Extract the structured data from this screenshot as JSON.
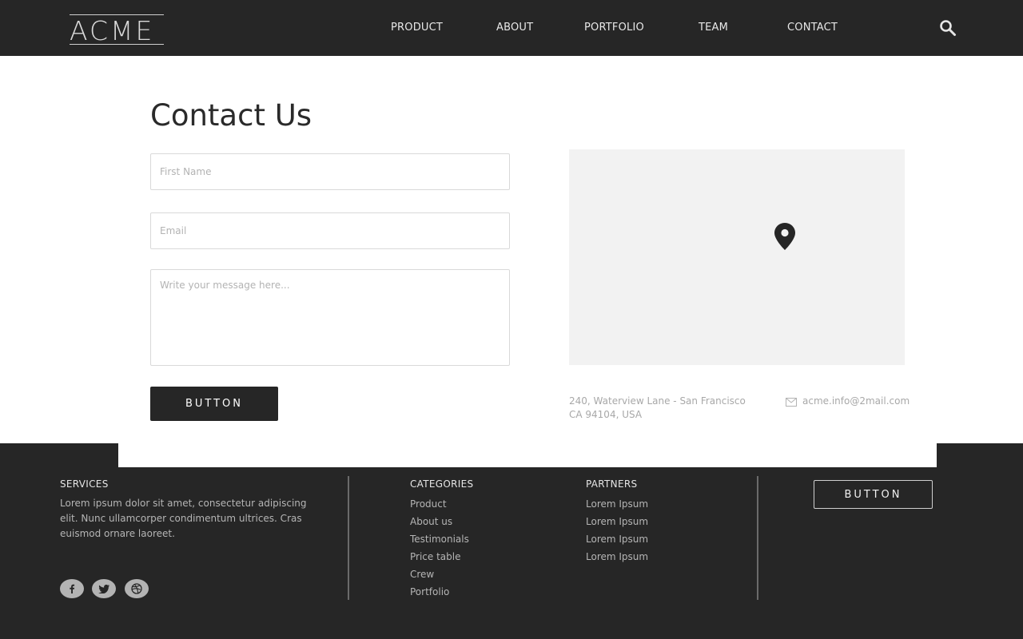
{
  "header": {
    "logo": "ACME",
    "nav": [
      "PRODUCT",
      "ABOUT",
      "PORTFOLIO",
      "TEAM",
      "CONTACT"
    ],
    "search_icon": "search-icon"
  },
  "contact": {
    "title": "Contact Us",
    "first_name_placeholder": "First Name",
    "email_placeholder": "Email",
    "message_placeholder": "Write your message here...",
    "button_label": "BUTTON",
    "map_icon": "map-pin-icon",
    "address_line1": "240, Waterview Lane - San Francisco",
    "address_line2": "CA 94104, USA",
    "email_icon": "mail-icon",
    "email": "acme.info@2mail.com"
  },
  "footer": {
    "services": {
      "heading": "SERVICES",
      "text": "Lorem ipsum dolor sit amet, consectetur adipiscing elit. Nunc ullamcorper condimentum ultrices. Cras euismod ornare laoreet."
    },
    "categories": {
      "heading": "CATEGORIES",
      "items": [
        "Product",
        "About us",
        "Testimonials",
        "Price table",
        "Crew",
        "Portfolio"
      ]
    },
    "partners": {
      "heading": "PARTNERS",
      "items": [
        "Lorem Ipsum",
        "Lorem Ipsum",
        "Lorem Ipsum",
        "Lorem Ipsum"
      ]
    },
    "social_icons": [
      "facebook-icon",
      "twitter-icon",
      "dribbble-icon"
    ],
    "button_label": "BUTTON"
  },
  "colors": {
    "dark": "#262626",
    "map_bg": "#f2f2f2",
    "muted_text": "#a8a8a8"
  }
}
